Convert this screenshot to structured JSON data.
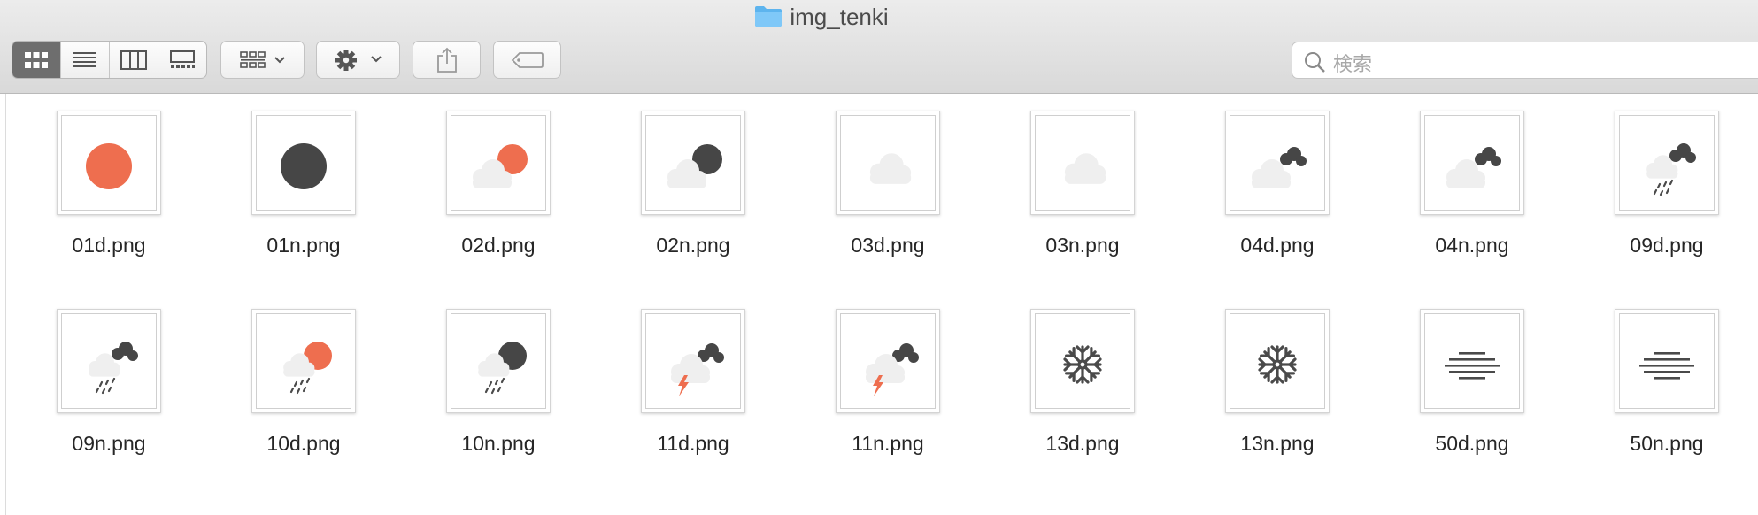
{
  "window": {
    "title": "img_tenki"
  },
  "toolbar": {
    "view_modes": [
      "icon-view",
      "list-view",
      "column-view",
      "gallery-view"
    ],
    "active_view": "icon-view",
    "buttons": [
      "group-button",
      "action-gear-button",
      "share-button",
      "tag-button"
    ]
  },
  "search": {
    "placeholder": "検索"
  },
  "files": [
    {
      "name": "01d.png",
      "icon": "clear-day"
    },
    {
      "name": "01n.png",
      "icon": "clear-night"
    },
    {
      "name": "02d.png",
      "icon": "few-clouds-day"
    },
    {
      "name": "02n.png",
      "icon": "few-clouds-night"
    },
    {
      "name": "03d.png",
      "icon": "scattered-clouds"
    },
    {
      "name": "03n.png",
      "icon": "scattered-clouds"
    },
    {
      "name": "04d.png",
      "icon": "broken-clouds"
    },
    {
      "name": "04n.png",
      "icon": "broken-clouds"
    },
    {
      "name": "09d.png",
      "icon": "shower-rain"
    },
    {
      "name": "09n.png",
      "icon": "shower-rain"
    },
    {
      "name": "10d.png",
      "icon": "rain-day"
    },
    {
      "name": "10n.png",
      "icon": "rain-night"
    },
    {
      "name": "11d.png",
      "icon": "thunderstorm"
    },
    {
      "name": "11n.png",
      "icon": "thunderstorm"
    },
    {
      "name": "13d.png",
      "icon": "snow"
    },
    {
      "name": "13n.png",
      "icon": "snow"
    },
    {
      "name": "50d.png",
      "icon": "mist"
    },
    {
      "name": "50n.png",
      "icon": "mist"
    }
  ],
  "colors": {
    "sun": "#EE6E4F",
    "dark": "#464646",
    "cloud": "#EFEFEF",
    "rain": "#4A4A4A"
  }
}
